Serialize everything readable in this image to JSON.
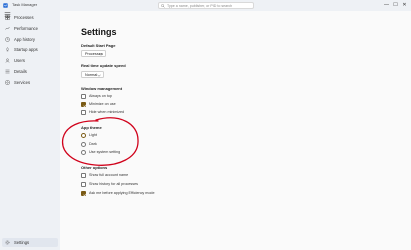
{
  "window": {
    "title": "Task Manager",
    "search_placeholder": "Type a name, publisher, or PID to search",
    "controls": {
      "minimize": "—",
      "maximize": "☐",
      "close": "✕"
    }
  },
  "nav": {
    "items": [
      {
        "label": "Processes",
        "icon": "processes-icon"
      },
      {
        "label": "Performance",
        "icon": "performance-icon"
      },
      {
        "label": "App history",
        "icon": "app-history-icon"
      },
      {
        "label": "Startup apps",
        "icon": "startup-icon"
      },
      {
        "label": "Users",
        "icon": "users-icon"
      },
      {
        "label": "Details",
        "icon": "details-icon"
      },
      {
        "label": "Services",
        "icon": "services-icon"
      }
    ],
    "settings_label": "Settings"
  },
  "settings": {
    "title": "Settings",
    "default_start_page": {
      "title": "Default Start Page",
      "value": "Processes"
    },
    "update_speed": {
      "title": "Real time update speed",
      "value": "Normal"
    },
    "window_management": {
      "title": "Window management",
      "options": [
        {
          "label": "Always on top",
          "checked": false
        },
        {
          "label": "Minimize on use",
          "checked": true
        },
        {
          "label": "Hide when minimized",
          "checked": false
        }
      ]
    },
    "app_theme": {
      "title": "App theme",
      "options": [
        {
          "label": "Light",
          "selected": true
        },
        {
          "label": "Dark",
          "selected": false
        },
        {
          "label": "Use system setting",
          "selected": false
        }
      ]
    },
    "other_options": {
      "title": "Other options",
      "options": [
        {
          "label": "Show full account name",
          "checked": false
        },
        {
          "label": "Show history for all processes",
          "checked": false
        },
        {
          "label": "Ask me before applying Efficiency mode",
          "checked": true
        }
      ]
    }
  },
  "colors": {
    "accent": "#7a5a14",
    "annotation": "#d0021b",
    "nav_bg": "#eef1f5",
    "content_bg": "#fafafa"
  }
}
